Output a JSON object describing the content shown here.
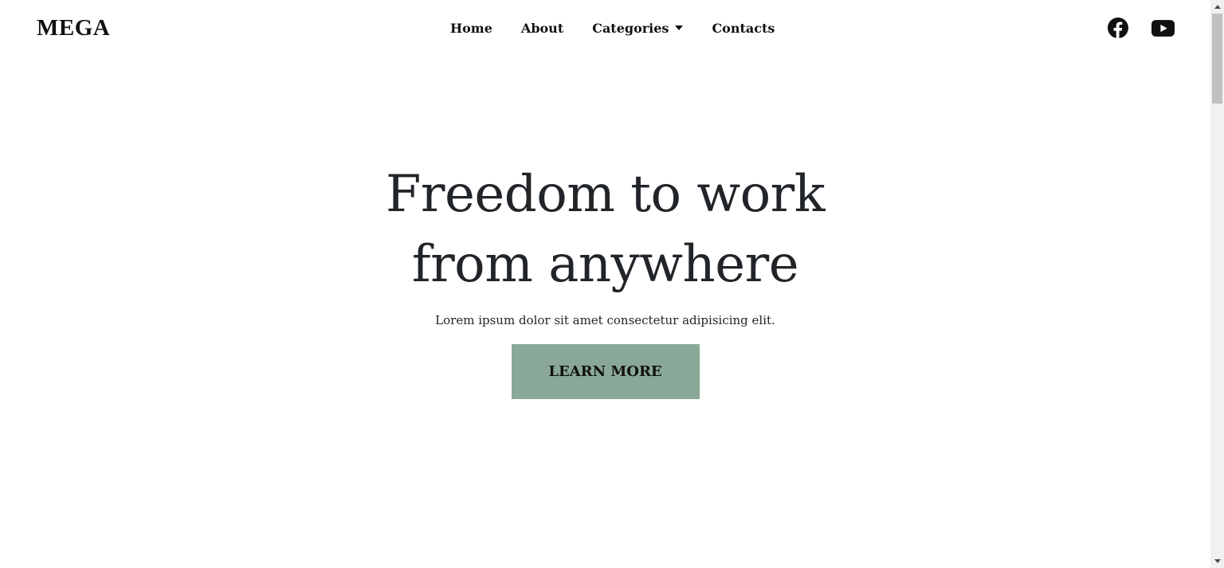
{
  "brand": {
    "name": "MEGA"
  },
  "nav": {
    "home": "Home",
    "about": "About",
    "categories": "Categories",
    "contacts": "Contacts"
  },
  "social": {
    "facebook_icon": "facebook-icon",
    "youtube_icon": "youtube-icon"
  },
  "hero": {
    "title_line1": "Freedom to work",
    "title_line2": "from anywhere",
    "subtitle": "Lorem ipsum dolor sit amet consectetur adipisicing elit.",
    "cta_label": "LEARN MORE"
  },
  "colors": {
    "accent": "#8aa897",
    "text": "#212529",
    "background": "#ffffff"
  }
}
